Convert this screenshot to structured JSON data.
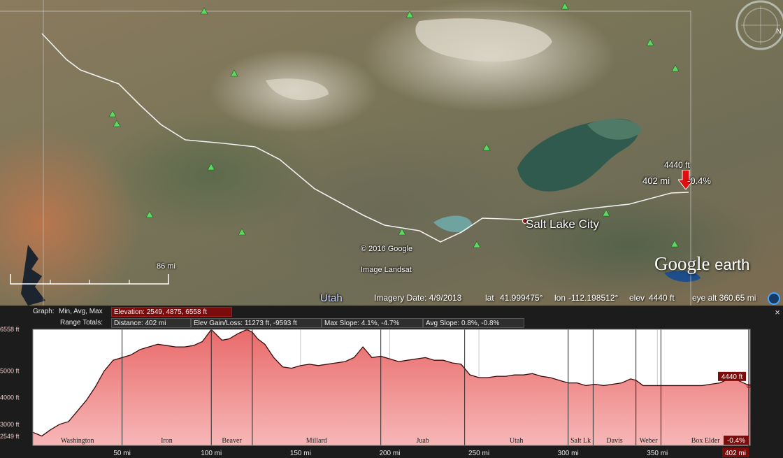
{
  "map": {
    "city": "Salt Lake City",
    "state": "Utah",
    "copyright": "© 2016 Google",
    "imagery_source": "Image Landsat",
    "scale": "86 mi",
    "logo_main": "Google",
    "logo_sub": "earth",
    "marker": {
      "elevation": "4440 ft",
      "distance": "402 mi",
      "slope": "-0.4%"
    },
    "icons": [
      "compass-icon",
      "peak-icon",
      "help-icon",
      "close-icon"
    ]
  },
  "status": {
    "imagery_date": "Imagery Date: 4/9/2013",
    "lat_label": "lat",
    "lat": "41.999475°",
    "lon_label": "lon",
    "lon": "-112.198512°",
    "elev_label": "elev",
    "elev": "4440 ft",
    "eye_alt": "eye alt 360.65 mi"
  },
  "profile": {
    "graph_label": "Graph:",
    "graph_modes": "Min, Avg, Max",
    "elevation_summary": "Elevation: 2549, 4875, 6558 ft",
    "range_label": "Range Totals:",
    "distance": "Distance: 402 mi",
    "gain_loss": "Elev Gain/Loss: 11273 ft, -9593 ft",
    "max_slope": "Max Slope: 4.1%, -4.7%",
    "avg_slope": "Avg Slope: 0.8%, -0.8%",
    "close": "×",
    "cursor_elevation": "4440 ft",
    "cursor_slope": "-0.4%",
    "cursor_distance": "402 mi"
  },
  "chart_data": {
    "type": "area",
    "x_unit": "mi",
    "y_unit": "ft",
    "xlim": [
      0,
      402
    ],
    "ylim": [
      2549,
      6558
    ],
    "x_ticks": [
      "50 mi",
      "100 mi",
      "150 mi",
      "200 mi",
      "250 mi",
      "300 mi",
      "350 mi"
    ],
    "x_tick_values": [
      50,
      100,
      150,
      200,
      250,
      300,
      350
    ],
    "y_ticks": [
      "6558 ft",
      "5000 ft",
      "4000 ft",
      "3000 ft",
      "2549 ft"
    ],
    "y_tick_values": [
      6558,
      5000,
      4000,
      3000,
      2549
    ],
    "regions": [
      {
        "name": "Washington",
        "start": 0,
        "end": 50
      },
      {
        "name": "Iron",
        "start": 50,
        "end": 100
      },
      {
        "name": "Beaver",
        "start": 100,
        "end": 123
      },
      {
        "name": "Millard",
        "start": 123,
        "end": 195
      },
      {
        "name": "Juab",
        "start": 195,
        "end": 242
      },
      {
        "name": "Utah",
        "start": 242,
        "end": 300
      },
      {
        "name": "Salt Lk",
        "start": 300,
        "end": 314
      },
      {
        "name": "Davis",
        "start": 314,
        "end": 338
      },
      {
        "name": "Weber",
        "start": 338,
        "end": 352
      },
      {
        "name": "Box Elder",
        "start": 352,
        "end": 402
      }
    ],
    "series": [
      {
        "x": [
          0,
          5,
          10,
          15,
          20,
          25,
          30,
          35,
          40,
          45,
          50,
          55,
          60,
          65,
          70,
          75,
          80,
          85,
          90,
          95,
          100,
          103,
          106,
          110,
          115,
          120,
          123,
          126,
          130,
          135,
          140,
          145,
          150,
          155,
          160,
          165,
          170,
          175,
          180,
          185,
          190,
          195,
          200,
          205,
          210,
          215,
          220,
          225,
          230,
          235,
          240,
          245,
          250,
          255,
          260,
          265,
          270,
          275,
          280,
          285,
          290,
          295,
          300,
          305,
          310,
          315,
          320,
          325,
          330,
          335,
          338,
          342,
          346,
          350,
          355,
          360,
          365,
          370,
          375,
          380,
          385,
          390,
          395,
          400,
          402
        ],
        "values": [
          2700,
          2560,
          2800,
          3000,
          3100,
          3500,
          3900,
          4400,
          5000,
          5400,
          5500,
          5600,
          5800,
          5900,
          6000,
          5950,
          5900,
          5900,
          5950,
          6100,
          6550,
          6350,
          6150,
          6200,
          6400,
          6550,
          6450,
          6200,
          6000,
          5500,
          5150,
          5100,
          5200,
          5250,
          5200,
          5250,
          5300,
          5350,
          5500,
          5900,
          5500,
          5550,
          5450,
          5350,
          5400,
          5450,
          5500,
          5400,
          5400,
          5300,
          5250,
          4850,
          4750,
          4750,
          4800,
          4800,
          4850,
          4850,
          4900,
          4800,
          4750,
          4650,
          4550,
          4550,
          4450,
          4500,
          4450,
          4500,
          4550,
          4700,
          4650,
          4450,
          4450,
          4450,
          4450,
          4450,
          4450,
          4450,
          4450,
          4500,
          4550,
          4700,
          4650,
          4500,
          4440
        ]
      }
    ]
  }
}
